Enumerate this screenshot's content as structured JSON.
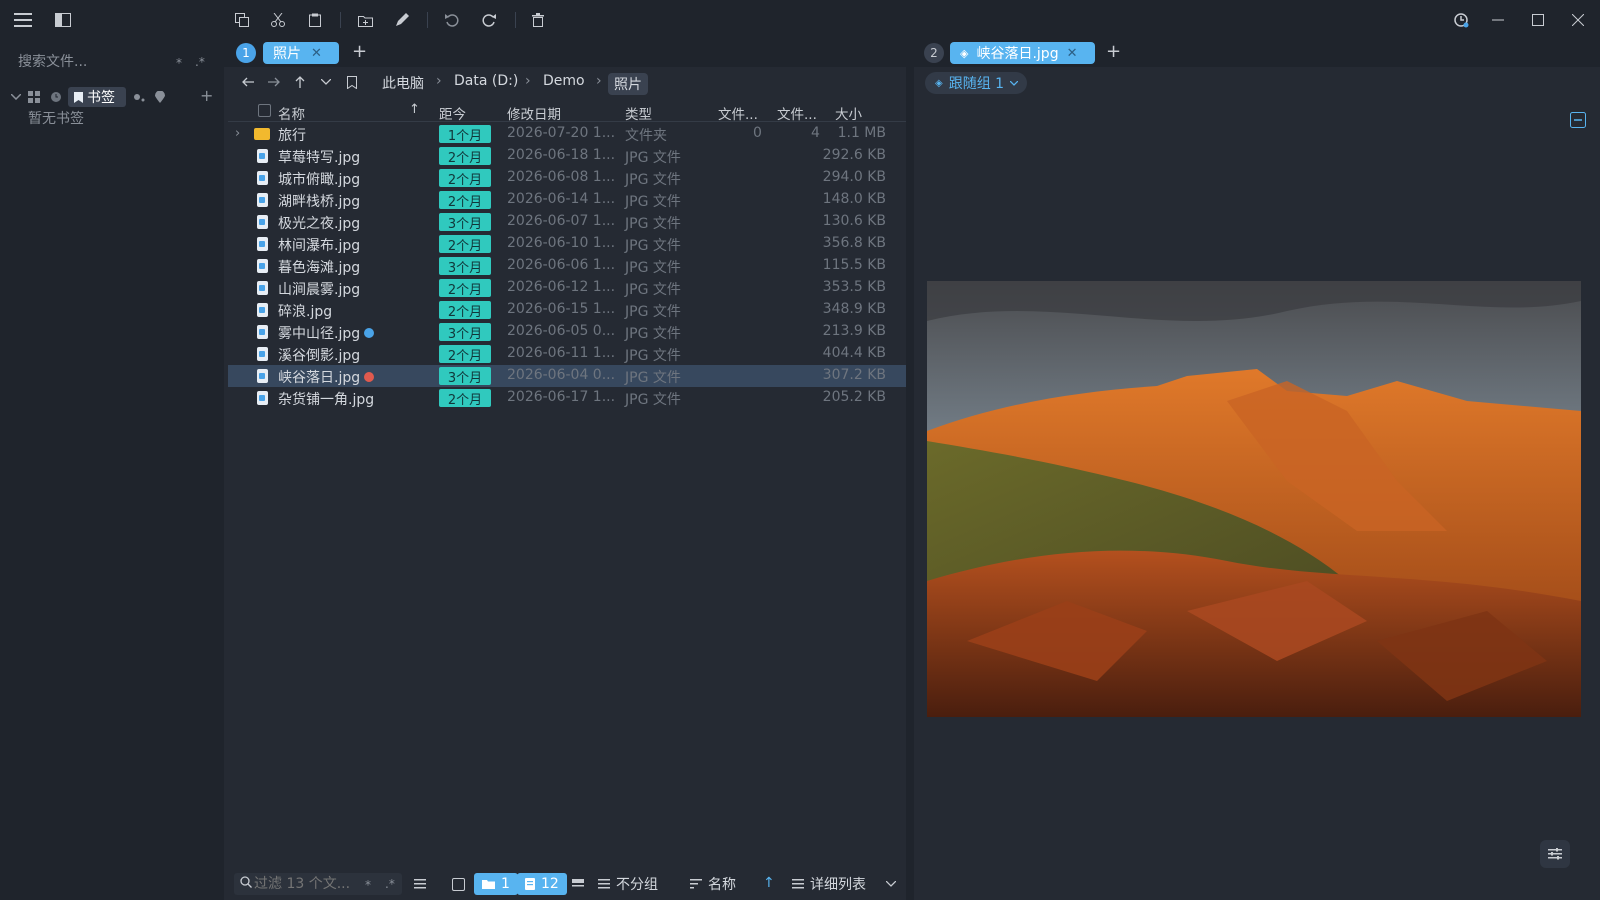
{
  "sidebar": {
    "search_placeholder": "搜索文件...",
    "glob_symbol": "*",
    "regex_symbol": ".*",
    "bookmarks_tab": "书签",
    "empty_text": "暂无书签"
  },
  "left_pane": {
    "tab_index": "1",
    "tab_label": "照片",
    "breadcrumb": [
      "此电脑",
      "Data (D:)",
      "Demo",
      "照片"
    ],
    "columns": [
      "名称",
      "距今",
      "修改日期",
      "类型",
      "文件...",
      "文件...",
      "大小"
    ],
    "rows": [
      {
        "name": "旅行",
        "age": "1个月",
        "date": "2026-07-20 1...",
        "type": "文件夹",
        "files1": "0",
        "files2": "4",
        "size": "1.1 MB",
        "kind": "folder"
      },
      {
        "name": "草莓特写.jpg",
        "age": "2个月",
        "date": "2026-06-18 1...",
        "type": "JPG 文件",
        "size": "292.6 KB"
      },
      {
        "name": "城市俯瞰.jpg",
        "age": "2个月",
        "date": "2026-06-08 1...",
        "type": "JPG 文件",
        "size": "294.0 KB"
      },
      {
        "name": "湖畔栈桥.jpg",
        "age": "2个月",
        "date": "2026-06-14 1...",
        "type": "JPG 文件",
        "size": "148.0 KB"
      },
      {
        "name": "极光之夜.jpg",
        "age": "3个月",
        "date": "2026-06-07 1...",
        "type": "JPG 文件",
        "size": "130.6 KB"
      },
      {
        "name": "林间瀑布.jpg",
        "age": "2个月",
        "date": "2026-06-10 1...",
        "type": "JPG 文件",
        "size": "356.8 KB"
      },
      {
        "name": "暮色海滩.jpg",
        "age": "3个月",
        "date": "2026-06-06 1...",
        "type": "JPG 文件",
        "size": "115.5 KB"
      },
      {
        "name": "山涧晨雾.jpg",
        "age": "2个月",
        "date": "2026-06-12 1...",
        "type": "JPG 文件",
        "size": "353.5 KB"
      },
      {
        "name": "碎浪.jpg",
        "age": "2个月",
        "date": "2026-06-15 1...",
        "type": "JPG 文件",
        "size": "348.9 KB"
      },
      {
        "name": "雾中山径.jpg",
        "age": "3个月",
        "date": "2026-06-05 0...",
        "type": "JPG 文件",
        "size": "213.9 KB",
        "tag_color": "#4aa3e8"
      },
      {
        "name": "溪谷倒影.jpg",
        "age": "2个月",
        "date": "2026-06-11 1...",
        "type": "JPG 文件",
        "size": "404.4 KB"
      },
      {
        "name": "峡谷落日.jpg",
        "age": "3个月",
        "date": "2026-06-04 0...",
        "type": "JPG 文件",
        "size": "307.2 KB",
        "tag_color": "#e05a4e",
        "selected": true
      },
      {
        "name": "杂货铺一角.jpg",
        "age": "2个月",
        "date": "2026-06-17 1...",
        "type": "JPG 文件",
        "size": "205.2 KB"
      }
    ],
    "status": {
      "filter_placeholder": "过滤 13 个文...",
      "glob_symbol": "*",
      "regex_symbol": ".*",
      "folder_count": "1",
      "file_count": "12",
      "group_label": "不分组",
      "sort_label": "名称",
      "view_label": "详细列表"
    }
  },
  "right_pane": {
    "tab_index": "2",
    "tab_label": "峡谷落日.jpg",
    "follow_group": "跟随组 1"
  },
  "colors": {
    "accent": "#58b4f0",
    "age_badge": "#30c9be",
    "background": "#1f242c",
    "pane": "#252a33"
  }
}
